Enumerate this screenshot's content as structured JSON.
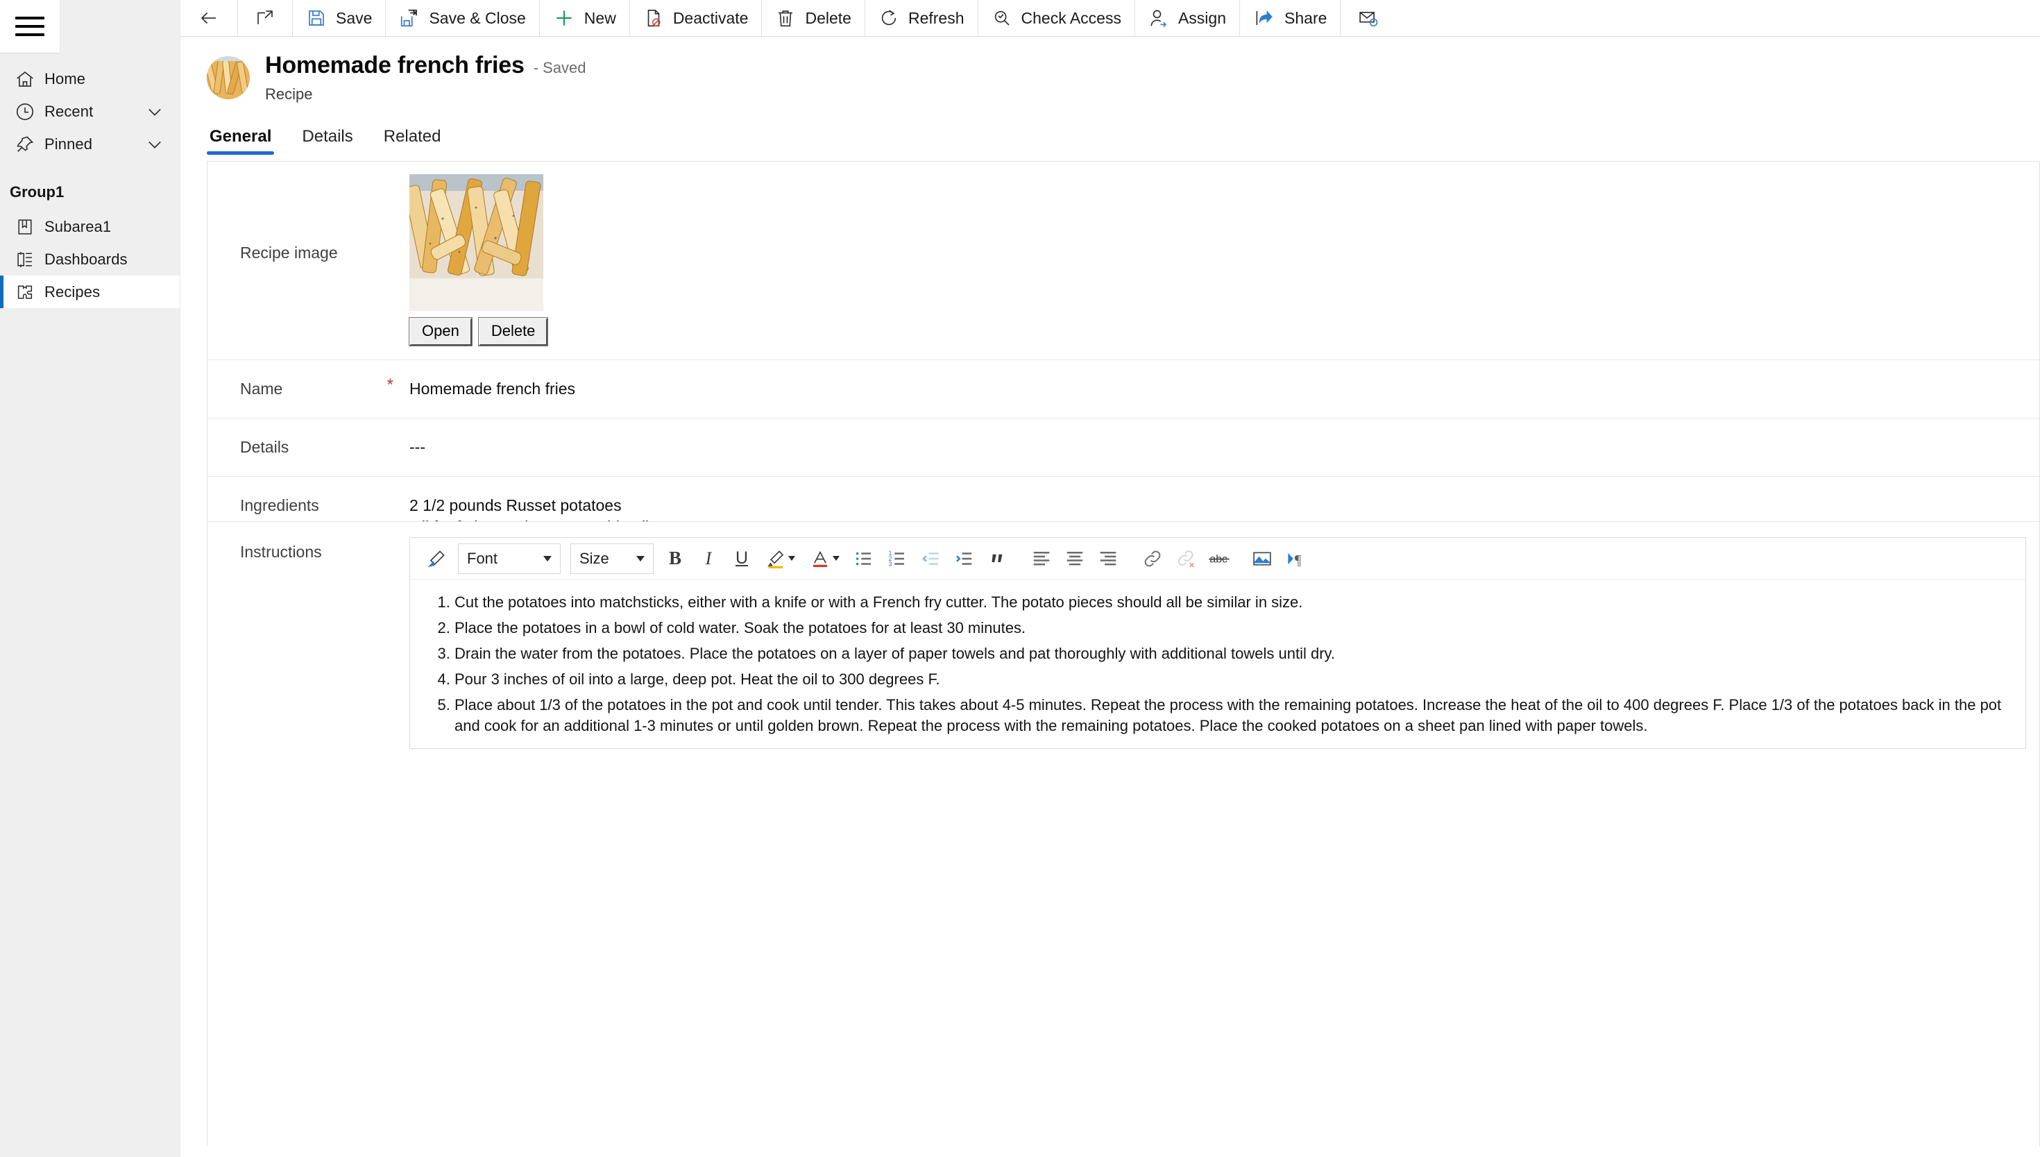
{
  "sidebar": {
    "menu_button": "hamburger-menu",
    "items": [
      {
        "label": "Home",
        "icon": "home-icon",
        "expandable": false,
        "selected": false
      },
      {
        "label": "Recent",
        "icon": "clock-icon",
        "expandable": true,
        "selected": false
      },
      {
        "label": "Pinned",
        "icon": "pin-icon",
        "expandable": true,
        "selected": false
      }
    ],
    "group_title": "Group1",
    "group_items": [
      {
        "label": "Subarea1",
        "icon": "book-icon",
        "selected": false
      },
      {
        "label": "Dashboards",
        "icon": "dashboard-icon",
        "selected": false
      },
      {
        "label": "Recipes",
        "icon": "puzzle-icon",
        "selected": true
      }
    ]
  },
  "commandbar": {
    "back": {
      "label": "",
      "icon": "back-arrow-icon"
    },
    "popout": {
      "label": "",
      "icon": "open-in-new-window-icon"
    },
    "items": [
      {
        "label": "Save",
        "icon": "save-icon"
      },
      {
        "label": "Save & Close",
        "icon": "save-and-close-icon"
      },
      {
        "label": "New",
        "icon": "plus-icon"
      },
      {
        "label": "Deactivate",
        "icon": "deactivate-icon"
      },
      {
        "label": "Delete",
        "icon": "trash-icon"
      },
      {
        "label": "Refresh",
        "icon": "refresh-icon"
      },
      {
        "label": "Check Access",
        "icon": "check-access-icon"
      },
      {
        "label": "Assign",
        "icon": "assign-user-icon"
      },
      {
        "label": "Share",
        "icon": "share-icon"
      },
      {
        "label": "",
        "icon": "email-link-icon"
      }
    ]
  },
  "record": {
    "title": "Homemade french fries",
    "status": "- Saved",
    "entity": "Recipe",
    "avatar": "recipe-photo-avatar"
  },
  "tabs": [
    {
      "label": "General",
      "active": true
    },
    {
      "label": "Details",
      "active": false
    },
    {
      "label": "Related",
      "active": false
    }
  ],
  "form": {
    "image_field": {
      "label": "Recipe image",
      "open_button": "Open",
      "delete_button": "Delete"
    },
    "name_field": {
      "label": "Name",
      "required_marker": "*",
      "value": "Homemade french fries"
    },
    "details_field": {
      "label": "Details",
      "value": "---"
    },
    "ingredients_field": {
      "label": "Ingredients",
      "lines": [
        "2 1/2 pounds Russet potatoes",
        "Oil for frying such as vegetable oil"
      ]
    },
    "instructions_field": {
      "label": "Instructions",
      "editor": {
        "font_select": "Font",
        "size_select": "Size",
        "buttons": [
          "format-painter-icon",
          "bold-icon",
          "italic-icon",
          "underline-icon",
          "highlight-color-icon",
          "font-color-icon",
          "bulleted-list-icon",
          "numbered-list-icon",
          "decrease-indent-icon",
          "increase-indent-icon",
          "blockquote-icon",
          "align-left-icon",
          "align-center-icon",
          "align-right-icon",
          "insert-link-icon",
          "remove-link-icon",
          "strikethrough-icon",
          "insert-image-icon",
          "text-direction-icon"
        ],
        "steps": [
          "Cut the potatoes into matchsticks, either with a knife or with a French fry cutter. The potato pieces should all be similar in size.",
          "Place the potatoes in a bowl of cold water. Soak the potatoes for at least 30 minutes.",
          "Drain the water from the potatoes. Place the potatoes on a layer of paper towels and pat thoroughly with additional towels until dry.",
          "Pour 3 inches of oil into a large, deep pot. Heat the oil to 300 degrees F.",
          "Place about 1/3 of the potatoes in the pot and cook until tender. This takes about 4-5 minutes. Repeat the process with the remaining potatoes. Increase the heat of the oil to 400 degrees F. Place 1/3 of the potatoes back in the pot and cook for an additional 1-3 minutes or until golden brown. Repeat the process with the remaining potatoes. Place the cooked potatoes on a sheet pan lined with paper towels."
        ]
      }
    }
  },
  "colors": {
    "accent_blue": "#2266d3",
    "nav_selected_bar": "#0f6cbd",
    "sidebar_bg": "#efefef",
    "required_red": "#c0392b",
    "save_icon_blue": "#3a7dc9",
    "new_green": "#179a54"
  }
}
